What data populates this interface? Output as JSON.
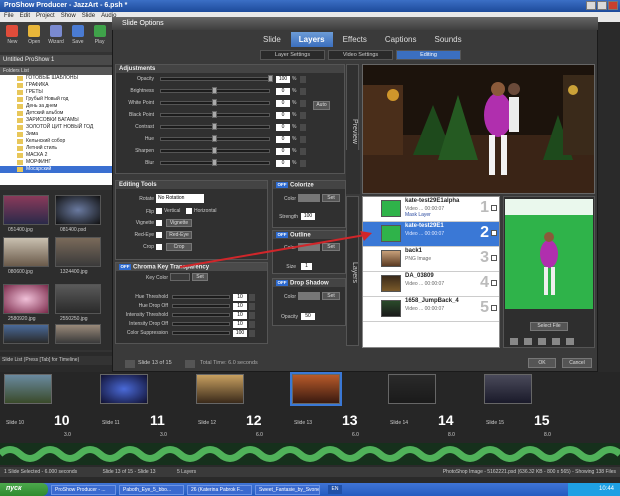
{
  "app": {
    "title": "ProShow Producer - JazzArt - 6.psh *",
    "menu": [
      "File",
      "Edit",
      "Project",
      "Show",
      "Slide",
      "Audio"
    ],
    "toolbar": [
      "New",
      "Open",
      "Wizard",
      "Save",
      "Play"
    ],
    "project_tab": "Untitled ProShow 1",
    "folders_label": "Folders List",
    "folders": [
      "ГОТОВЫЕ ШАБЛОНЫ",
      "ГРАФИКА",
      "ГРЕТЫ",
      "Грубый Новый год",
      "День за днем",
      "Детский альбом",
      "ЗАРИСОВКИ БАГАМЫ",
      "ЗОЛОТОЙ ЦИТ НОВЫЙ ГОД",
      "Зима",
      "Кельнский собор",
      "Летний стиль",
      "МАСКА 2",
      "МОРФИНГ",
      "Мосарский"
    ],
    "thumbnails": [
      "051400.jpg",
      "081400.psd",
      "",
      "",
      "080600.jpg",
      "",
      "",
      "1324400.jpg",
      "2580920.jpg",
      "2550250.jpg",
      "",
      "2580870.jpg"
    ]
  },
  "dialog": {
    "title": "Slide Options",
    "tabs": [
      "Slide",
      "Layers",
      "Effects",
      "Captions",
      "Sounds"
    ],
    "active_tab": "Layers",
    "subtabs": [
      "Layer Settings",
      "Video Settings",
      "Editing"
    ],
    "adjustments": {
      "header": "Adjustments",
      "rows": [
        {
          "label": "Opacity",
          "value": "100",
          "unit": "%"
        },
        {
          "label": "Brightness",
          "value": "0",
          "unit": "%"
        },
        {
          "label": "White Point",
          "value": "0",
          "unit": "%"
        },
        {
          "label": "Black Point",
          "value": "0",
          "unit": "%"
        },
        {
          "label": "Contrast",
          "value": "0",
          "unit": "%"
        },
        {
          "label": "Hue",
          "value": "0",
          "unit": "%"
        },
        {
          "label": "Sharpen",
          "value": "0",
          "unit": "%"
        },
        {
          "label": "Blur",
          "value": "0",
          "unit": "%"
        }
      ],
      "auto_button": "Auto"
    },
    "editing_tools": {
      "header": "Editing Tools",
      "rotate_label": "Rotate",
      "rotate_value": "No Rotation",
      "flip_label": "Flip",
      "flip_vertical": "Vertical",
      "flip_horizontal": "Horizontal",
      "vignette_label": "Vignette",
      "vignette_button": "Vignette",
      "redeye_label": "Red-Eye",
      "redeye_button": "Red-Eye",
      "crop_label": "Crop",
      "crop_button": "Crop"
    },
    "colorize": {
      "off": "OFF",
      "header": "Colorize",
      "color_label": "Color",
      "set_button": "Set",
      "strength_label": "Strength",
      "strength_value": "100"
    },
    "outline": {
      "off": "OFF",
      "header": "Outline",
      "color_label": "Color",
      "set_button": "Set",
      "size_label": "Size",
      "size_value": "1"
    },
    "shadow": {
      "off": "OFF",
      "header": "Drop Shadow",
      "color_label": "Color",
      "set_button": "Set",
      "opacity_label": "Opacity",
      "opacity_value": "50"
    },
    "chroma": {
      "off": "OFF",
      "header": "Chroma Key Transparency",
      "key_color_label": "Key Color",
      "set_button": "Set",
      "rows": [
        {
          "label": "Hue Threshold",
          "value": "10"
        },
        {
          "label": "Hue Drop Off",
          "value": "10"
        },
        {
          "label": "Intensity Threshold",
          "value": "10"
        },
        {
          "label": "Intensity Drop Off",
          "value": "10"
        },
        {
          "label": "Color Suppression",
          "value": "100"
        }
      ]
    },
    "preview_label": "Preview",
    "layers_label": "Layers",
    "layers": [
      {
        "name": "kate-test29E1alpha",
        "sub": "Video ... 00:00:07",
        "sub2": "Mask Layer",
        "num": "1"
      },
      {
        "name": "kate-test29E1",
        "sub": "Video ... 00:00:07",
        "sub2": "",
        "num": "2"
      },
      {
        "name": "back1",
        "sub": "PNG Image",
        "sub2": "",
        "num": "3"
      },
      {
        "name": "DA_03809",
        "sub": "Video ... 00:00:07",
        "sub2": "",
        "num": "4"
      },
      {
        "name": "1658_JumpBack_4",
        "sub": "Video ... 00:00:07",
        "sub2": "",
        "num": "5"
      }
    ],
    "select_file": "Select File",
    "nav_text": "Slide 13 of 15",
    "total_time": "Total Time: 6.0 seconds",
    "ok": "OK",
    "cancel": "Cancel"
  },
  "timeline": {
    "label": "Slide List (Press [Tab] for Timeline)",
    "slides": [
      {
        "label": "Slide 10",
        "num": "10",
        "time": "3.0"
      },
      {
        "label": "Slide 11",
        "num": "11",
        "time": "3.0"
      },
      {
        "label": "Slide 12",
        "num": "12",
        "time": "6.0"
      },
      {
        "label": "Slide 13",
        "num": "13",
        "time": "6.0"
      },
      {
        "label": "Slide 14",
        "num": "14",
        "time": "8.0"
      },
      {
        "label": "Slide 15",
        "num": "15",
        "time": "8.0"
      }
    ]
  },
  "status": {
    "left": "1 Slide Selected - 6.000 seconds",
    "mid": "Slide 13 of 15 - Slide 13",
    "layers": "5 Layers",
    "right": "PhotoShop Image - 5162221.psd (636.32 KB - 800 x 565) - Showing 138 Files"
  },
  "taskbar": {
    "start": "пуск",
    "tasks": [
      "ProShow Producer - ...",
      "Paboth_Eye_5_bbo...",
      "26 (Katerina Pabrok F...",
      "Sweet_Fantasie_by_Svone..."
    ],
    "lang": "EN",
    "clock": "10:44"
  },
  "colors": {
    "accent": "#3b6fbf",
    "selected_layer": "#3a78d6",
    "chroma_green": "#2fb34a",
    "arrow_red": "#d0262a"
  }
}
